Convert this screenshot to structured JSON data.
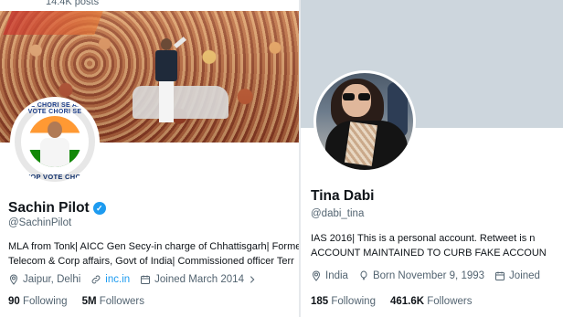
{
  "left_profile": {
    "posts_count": "14.4K posts",
    "avatar_ring": {
      "top": "VOTE CHORI SE AZADI VOTE CHORI SE",
      "bottom": "STOP VOTE CHORI"
    },
    "name": "Sachin Pilot",
    "verified_mark": "✓",
    "handle": "@SachinPilot",
    "bio_lines": [
      "MLA from Tonk| AICC Gen Secy-in charge of Chhattisgarh| Forme",
      "Telecom & Corp affairs, Govt of India| Commissioned officer Terr"
    ],
    "location": "Jaipur, Delhi",
    "website": "inc.in",
    "joined": "Joined March 2014",
    "following_count": "90",
    "following_label": "Following",
    "followers_count": "5M",
    "followers_label": "Followers"
  },
  "right_profile": {
    "name": "Tina Dabi",
    "handle": "@dabi_tina",
    "bio_lines": [
      "IAS 2016| This is a personal account. Retweet is n",
      "ACCOUNT MAINTAINED TO CURB FAKE ACCOUN"
    ],
    "location": "India",
    "birthday": "Born November 9, 1993",
    "joined": "Joined",
    "following_count": "185",
    "following_label": "Following",
    "followers_count": "461.6K",
    "followers_label": "Followers"
  },
  "colors": {
    "text_primary": "#0f1419",
    "text_secondary": "#536471",
    "accent": "#1d9bf0",
    "banner_right": "#cdd6dd"
  },
  "icons": [
    "verified-badge-icon",
    "location-pin-icon",
    "link-icon",
    "calendar-icon",
    "chevron-right-icon",
    "balloon-icon"
  ]
}
